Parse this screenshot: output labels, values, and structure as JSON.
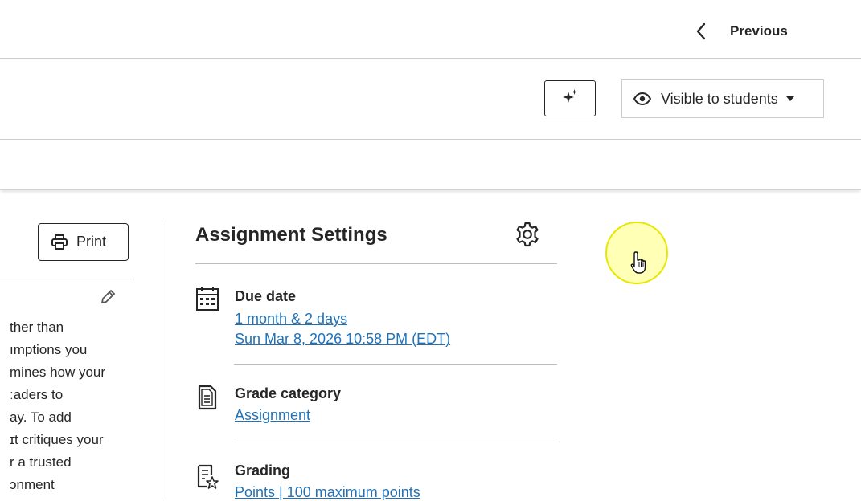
{
  "nav": {
    "previous_label": "Previous"
  },
  "toolbar": {
    "visibility_label": "Visible to students"
  },
  "left": {
    "print_label": "Print",
    "body_lines": [
      "ther than",
      "ımptions you",
      "mines how your",
      "ːaders to",
      "ay. To add",
      "ɪt critiques your",
      "r a trusted",
      "ɔnment"
    ]
  },
  "settings": {
    "title": "Assignment Settings",
    "due": {
      "title": "Due date",
      "relative": "1 month & 2 days",
      "date": "Sun Mar 8, 2026 10:58 PM (EDT)"
    },
    "category": {
      "title": "Grade category",
      "value": "Assignment"
    },
    "grading": {
      "title": "Grading",
      "value": "Points | 100 maximum points"
    }
  },
  "colors": {
    "link": "#1f72b8",
    "text": "#262626",
    "border": "#cdcdcd",
    "cursor_halo": "#ffff78"
  }
}
